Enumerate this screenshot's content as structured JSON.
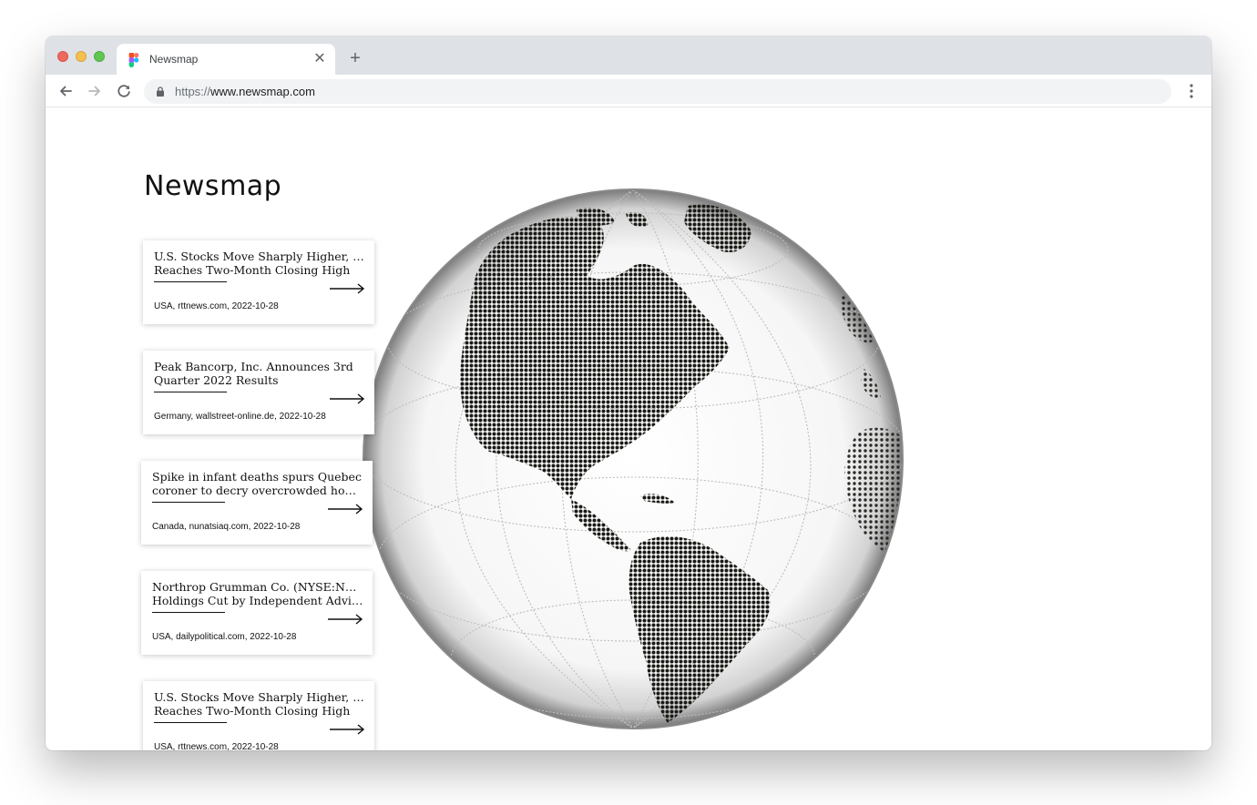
{
  "browser": {
    "tab_title": "Newsmap",
    "new_tab_label": "+",
    "close_label": "✕",
    "url_scheme": "https://",
    "url_host": "www.newsmap.com"
  },
  "page": {
    "title": "Newsmap"
  },
  "articles": [
    {
      "line1": "U.S. Stocks Move Sharply Higher, Dow",
      "line2": "Reaches Two-Month Closing High",
      "country": "USA",
      "source": "rttnews.com",
      "date": "2022-10-28",
      "meta": "USA, rttnews.com,  2022-10-28"
    },
    {
      "line1": "Peak Bancorp, Inc. Announces 3rd",
      "line2": "Quarter 2022 Results",
      "country": "Germany",
      "source": "wallstreet-online.de",
      "date": "2022-10-28",
      "meta": "Germany, wallstreet-online.de,  2022-10-28"
    },
    {
      "line1": "Spike in infant deaths spurs Quebec",
      "line2": "coroner to decry overcrowded housin...",
      "country": "Canada",
      "source": "nunatsiaq.com",
      "date": "2022-10-28",
      "meta": "Canada, nunatsiaq.com,  2022-10-28"
    },
    {
      "line1": "Northrop Grumman Co. (NYSE:NOC)",
      "line2": "Holdings Cut by Independent Advisor...",
      "country": "USA",
      "source": "dailypolitical.com",
      "date": "2022-10-28",
      "meta": "USA, dailypolitical.com,  2022-10-28"
    },
    {
      "line1": "U.S. Stocks Move Sharply Higher, Dow",
      "line2": "Reaches Two-Month Closing High",
      "country": "USA",
      "source": "rttnews.com",
      "date": "2022-10-28",
      "meta": "USA, rttnews.com,  2022-10-28"
    }
  ],
  "colors": {
    "traffic_red": "#ed6a5e",
    "traffic_yellow": "#f5bf4f",
    "traffic_green": "#61c554",
    "land_dots": "#1a1a16",
    "ink": "#111111"
  },
  "icons": [
    "figma-favicon-icon",
    "close-icon",
    "plus-icon",
    "back-arrow-icon",
    "forward-arrow-icon",
    "reload-icon",
    "lock-icon",
    "kebab-menu-icon",
    "arrow-right-icon",
    "globe-map"
  ]
}
